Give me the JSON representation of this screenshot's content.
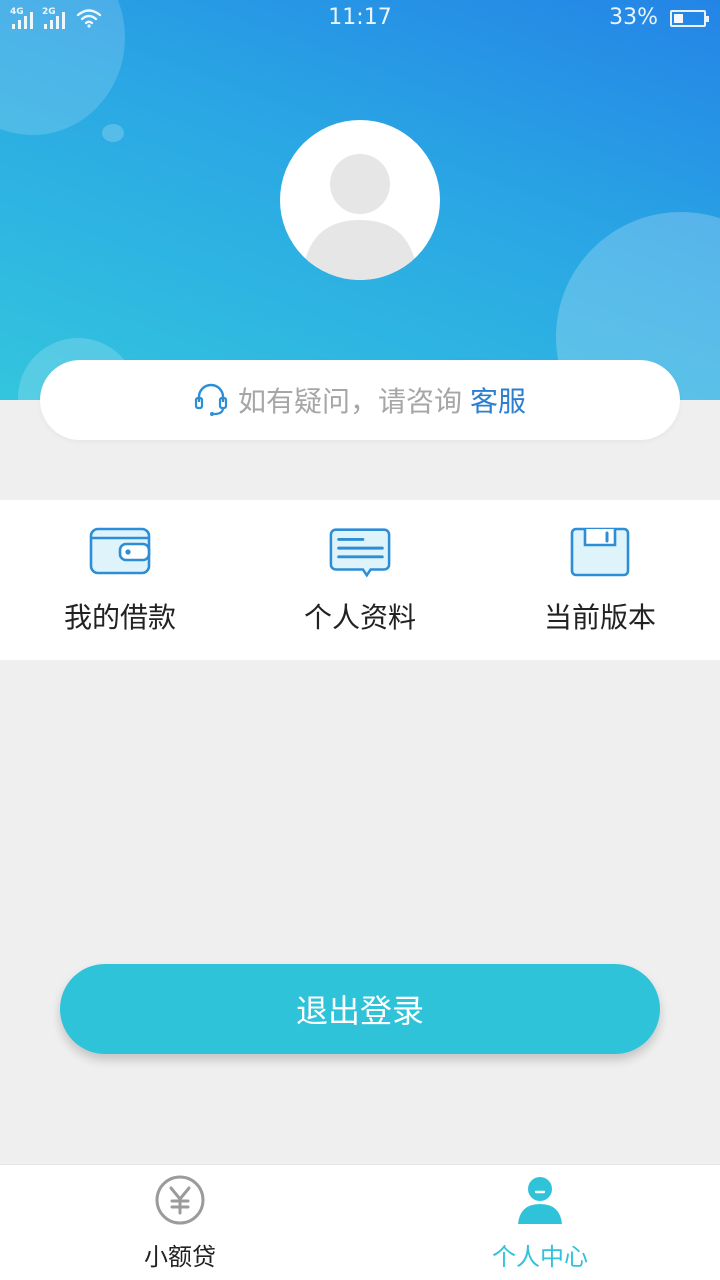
{
  "status_bar": {
    "network_1": "4G",
    "network_2": "2G",
    "time": "11:17",
    "battery_percent": "33%",
    "battery_level": 0.33
  },
  "help": {
    "text": "如有疑问，请咨询",
    "link": "客服",
    "icon": "headset-icon"
  },
  "menu": {
    "items": [
      {
        "label": "我的借款",
        "icon": "wallet-icon"
      },
      {
        "label": "个人资料",
        "icon": "chat-document-icon"
      },
      {
        "label": "当前版本",
        "icon": "floppy-disk-icon"
      }
    ]
  },
  "logout_label": "退出登录",
  "tabs": [
    {
      "label": "小额贷",
      "icon": "yen-coin-icon",
      "active": false
    },
    {
      "label": "个人中心",
      "icon": "user-profile-icon",
      "active": true
    }
  ],
  "colors": {
    "accent": "#2ec3d9",
    "link": "#2c7fd0",
    "header_start": "#2484e6",
    "header_end": "#33c5de"
  }
}
